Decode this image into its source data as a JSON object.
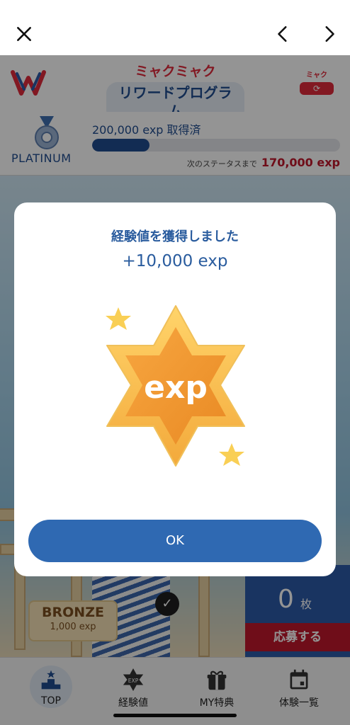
{
  "nav": {
    "close_icon": "close-icon",
    "back_icon": "chevron-left-icon",
    "forward_icon": "chevron-right-icon"
  },
  "header": {
    "title_line1": "ミャクミャク",
    "title_line2": "リワードプログラム",
    "badge_label": "ミャク",
    "badge_icon": "refresh-icon"
  },
  "status": {
    "rank": "PLATINUM",
    "exp_acquired": "200,000 exp 取得済",
    "progress_fraction": 0.23,
    "next_label": "次のステータスまで",
    "next_value": "170,000 exp"
  },
  "scene": {
    "bronze_title": "BRONZE",
    "bronze_exp": "1,000 exp",
    "check_icon": "✓",
    "ticket_count": "0",
    "ticket_unit": "枚",
    "apply_label": "応募する"
  },
  "tabs": [
    {
      "label": "TOP",
      "icon": "podium-icon"
    },
    {
      "label": "経験値",
      "icon": "exp-star-icon"
    },
    {
      "label": "MY特典",
      "icon": "gift-icon"
    },
    {
      "label": "体験一覧",
      "icon": "calendar-icon"
    }
  ],
  "modal": {
    "title": "経験値を獲得しました",
    "value": "+10,000 exp",
    "badge_text": "exp",
    "ok_label": "OK"
  },
  "colors": {
    "brand_blue": "#2f69b2",
    "title_blue": "#2a5c9e",
    "accent_red": "#c0182b",
    "star_orange": "#f0a230"
  }
}
